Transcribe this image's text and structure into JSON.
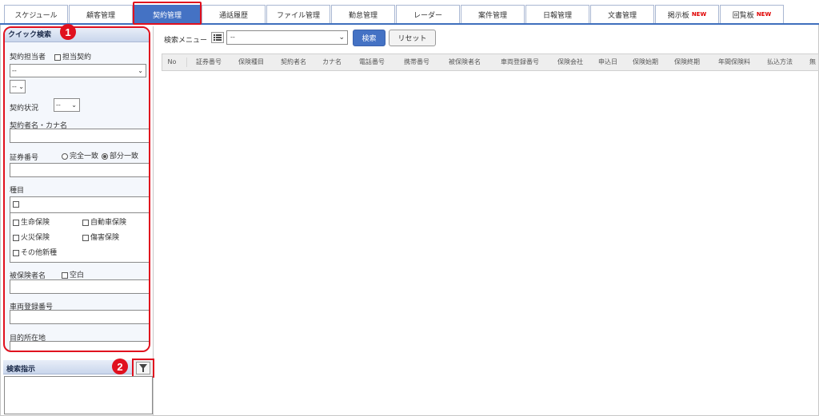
{
  "tabs": [
    {
      "label": "スケジュール",
      "active": false
    },
    {
      "label": "顧客管理",
      "active": false
    },
    {
      "label": "契約管理",
      "active": true
    },
    {
      "label": "通話履歴",
      "active": false
    },
    {
      "label": "ファイル管理",
      "active": false
    },
    {
      "label": "勤怠管理",
      "active": false
    },
    {
      "label": "レーダー",
      "active": false
    },
    {
      "label": "案件管理",
      "active": false
    },
    {
      "label": "日報管理",
      "active": false
    },
    {
      "label": "文書管理",
      "active": false
    },
    {
      "label": "掲示板",
      "active": false,
      "badge": "NEW"
    },
    {
      "label": "回覧板",
      "active": false,
      "badge": "NEW"
    }
  ],
  "quick_search": {
    "title": "クイック検索",
    "badge": "1",
    "contract_staff_label": "契約担当者",
    "my_contracts_label": "担当契約",
    "staff_select_value": "--",
    "staff_sub_select_value": "--",
    "contract_status_label": "契約状況",
    "contract_status_value": "--",
    "contractor_name_label": "契約者名・カナ名",
    "policy_number_label": "証券番号",
    "exact_match_label": "完全一致",
    "partial_match_label": "部分一致",
    "type_label": "種目",
    "types": {
      "life": "生命保険",
      "auto": "自動車保険",
      "fire": "火災保険",
      "injury": "傷害保険",
      "other": "その他新種"
    },
    "insured_name_label": "被保険者名",
    "blank_label": "空白",
    "vehicle_number_label": "車両登録番号",
    "destination_label": "目的所在地"
  },
  "search_instructions": {
    "title": "検索指示",
    "badge": "2"
  },
  "search_bar": {
    "menu_label": "検索メニュー",
    "menu_value": "--",
    "search_button": "検索",
    "reset_button": "リセット"
  },
  "table": {
    "columns": [
      "No",
      "証券番号",
      "保険種目",
      "契約者名",
      "カナ名",
      "電話番号",
      "携帯番号",
      "被保険者名",
      "車両登録番号",
      "保険会社",
      "申込日",
      "保険始期",
      "保険終期",
      "年間保険料",
      "払込方法",
      "無"
    ]
  },
  "colors": {
    "accent": "#4472c4",
    "highlight": "#e0101e",
    "new_badge": "#e00000"
  }
}
